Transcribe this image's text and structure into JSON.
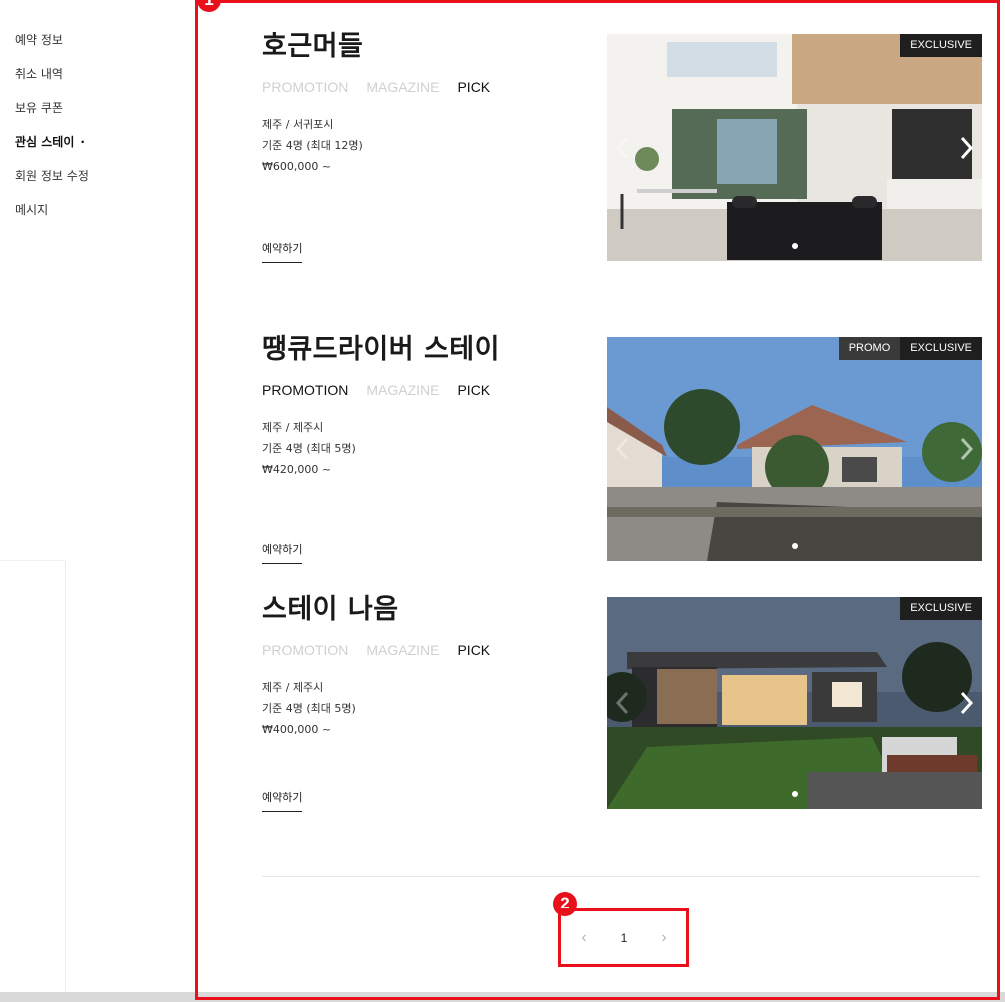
{
  "sidebar": {
    "items": [
      {
        "label": "예약 정보"
      },
      {
        "label": "취소 내역"
      },
      {
        "label": "보유 쿠폰"
      },
      {
        "label": "관심 스테이",
        "marker": "·"
      },
      {
        "label": "회원 정보 수정"
      },
      {
        "label": "메시지"
      }
    ]
  },
  "annotations": {
    "badge_1": "1",
    "badge_2": "2"
  },
  "stays": [
    {
      "name": "호근머들",
      "tags": [
        "PROMOTION",
        "MAGAZINE",
        "PICK"
      ],
      "active_tags": [
        "PICK"
      ],
      "location": "제주 / 서귀포시",
      "capacity": "기준 4명 (최대 12명)",
      "price": "₩600,000 ~",
      "book_label": "예약하기",
      "badges": [
        "EXCLUSIVE"
      ]
    },
    {
      "name": "땡큐드라이버 스테이",
      "tags": [
        "PROMOTION",
        "MAGAZINE",
        "PICK"
      ],
      "active_tags": [
        "PROMOTION",
        "PICK"
      ],
      "location": "제주 / 제주시",
      "capacity": "기준 4명 (최대 5명)",
      "price": "₩420,000 ~",
      "book_label": "예약하기",
      "badges": [
        "PROMO",
        "EXCLUSIVE"
      ]
    },
    {
      "name": "스테이 나음",
      "tags": [
        "PROMOTION",
        "MAGAZINE",
        "PICK"
      ],
      "active_tags": [
        "PICK"
      ],
      "location": "제주 / 제주시",
      "capacity": "기준 4명 (최대 5명)",
      "price": "₩400,000 ~",
      "book_label": "예약하기",
      "badges": [
        "EXCLUSIVE"
      ]
    }
  ],
  "pagination": {
    "prev": "‹",
    "current": "1",
    "next": "›"
  },
  "colors": {
    "annotation": "#e8101a",
    "tag_inactive": "#d0d0d0",
    "tag_active": "#111111"
  }
}
